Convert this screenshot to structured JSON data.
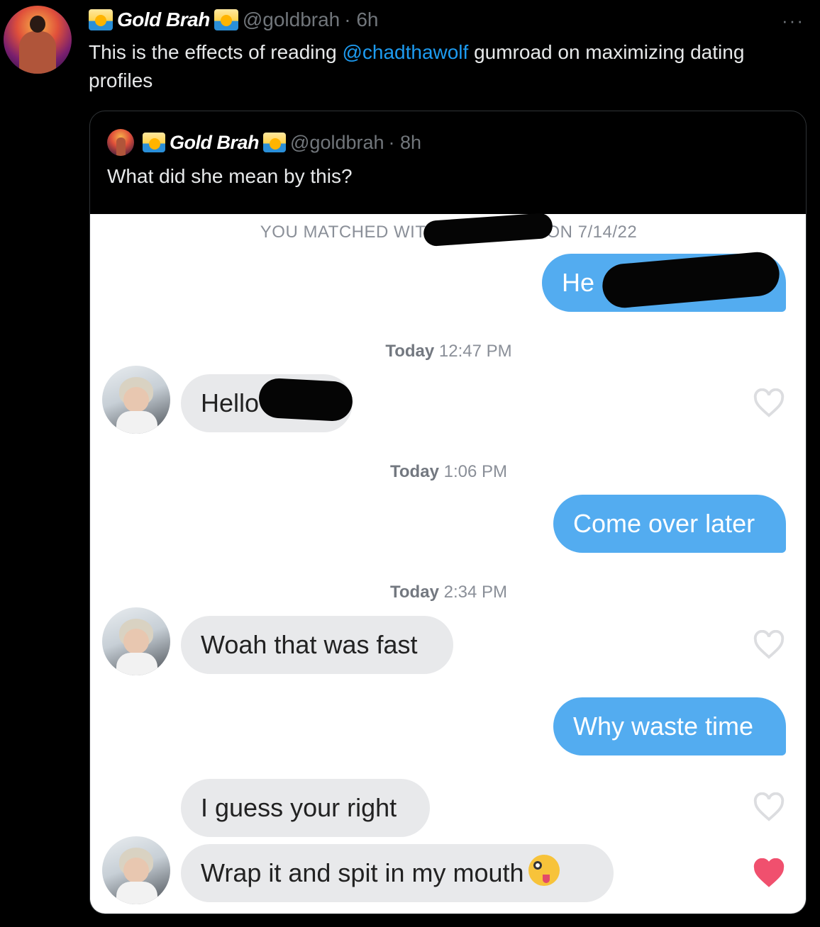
{
  "tweet": {
    "author": {
      "display_name": "Gold Brah",
      "handle": "@goldbrah",
      "time": "· 6h"
    },
    "text_before": "This is the effects of reading ",
    "mention": "@chadthawolf",
    "text_after": " gumroad on maximizing dating profiles",
    "more_label": "···"
  },
  "quoted_tweet": {
    "author": {
      "display_name": "Gold Brah",
      "handle": "@goldbrah",
      "time": "· 8h"
    },
    "text": "What did she mean by this?"
  },
  "chat": {
    "match_prefix": "YOU MATCHED WIT",
    "match_suffix": "ON 7/14/22",
    "messages": [
      {
        "dir": "out",
        "text": "He"
      },
      {
        "dir": "ts",
        "day": "Today",
        "time": "12:47 PM"
      },
      {
        "dir": "in",
        "text": "Hello",
        "liked": false
      },
      {
        "dir": "ts",
        "day": "Today",
        "time": "1:06 PM"
      },
      {
        "dir": "out",
        "text": "Come over later"
      },
      {
        "dir": "ts",
        "day": "Today",
        "time": "2:34 PM"
      },
      {
        "dir": "in",
        "text": "Woah that was fast",
        "liked": false
      },
      {
        "dir": "out",
        "text": "Why waste time"
      },
      {
        "dir": "in",
        "text": "I guess your right",
        "liked": false
      },
      {
        "dir": "in",
        "text": "Wrap it and spit in my mouth",
        "emoji": "zany-face-emoji",
        "liked": true
      }
    ]
  },
  "colors": {
    "background": "#000000",
    "link": "#1d9bf0",
    "outgoing_bubble": "#53acf0",
    "incoming_bubble": "#e8e9eb",
    "heart_liked": "#f0506e",
    "heart_unliked": "#dcdde0"
  }
}
